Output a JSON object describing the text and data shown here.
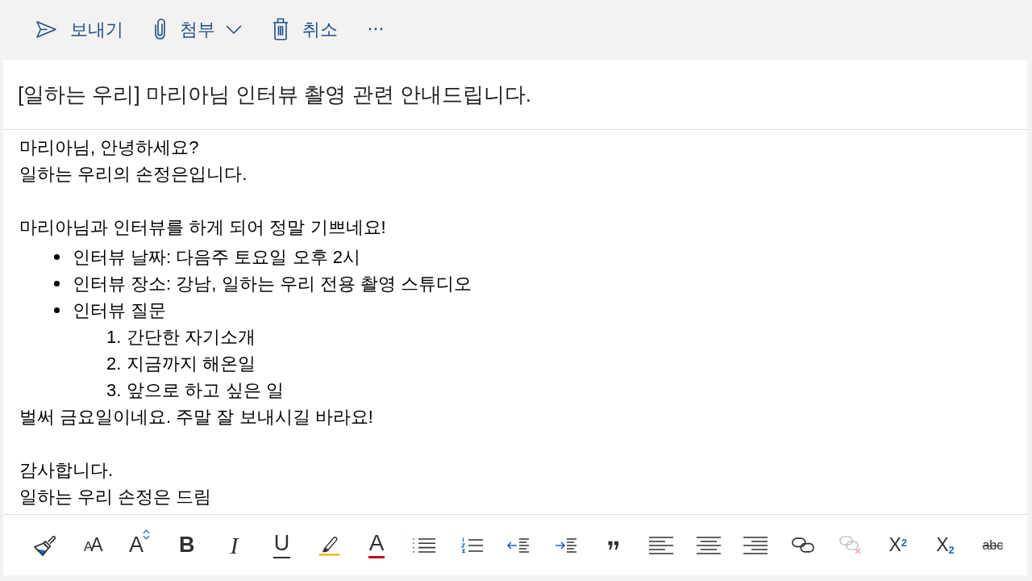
{
  "command_bar": {
    "items": [
      {
        "kind": "send",
        "label": "보내기",
        "has_menu": false
      },
      {
        "kind": "attach",
        "label": "첨부",
        "has_menu": true
      },
      {
        "kind": "discard",
        "label": "취소",
        "has_menu": false
      },
      {
        "kind": "more",
        "has_menu": false
      }
    ]
  },
  "subject": {
    "value": "[일하는 우리] 마리아님 인터뷰 촬영 관련 안내드립니다."
  },
  "body": {
    "sections": [
      {
        "blocks": [
          {
            "kind": "line",
            "text": "마리아님, 안녕하세요?"
          },
          {
            "kind": "line",
            "text": "일하는 우리의 손정은입니다."
          }
        ]
      },
      {
        "blocks": [
          {
            "kind": "line",
            "text": "마리아님과 인터뷰를 하게 되어 정말 기쁘네요!"
          },
          {
            "kind": "bullet_list",
            "items": [
              {
                "text": "인터뷰 날짜: 다음주 토요일 오후 2시"
              },
              {
                "text": "인터뷰 장소: 강남, 일하는 우리 전용 촬영 스튜디오"
              },
              {
                "text": "인터뷰 질문",
                "children": [
                  {
                    "number": "1.",
                    "text": "간단한 자기소개"
                  },
                  {
                    "number": "2.",
                    "text": "지금까지 해온일"
                  },
                  {
                    "number": "3.",
                    "text": "앞으로 하고 싶은 일"
                  }
                ]
              }
            ]
          },
          {
            "kind": "line",
            "text": "벌써 금요일이네요. 주말 잘 보내시길 바라요!"
          }
        ]
      },
      {
        "blocks": [
          {
            "kind": "line",
            "text": "감사합니다."
          },
          {
            "kind": "line",
            "text": "일하는 우리 손정은 드림"
          }
        ]
      }
    ]
  },
  "format_toolbar": {
    "items": [
      {
        "kind": "format_painter",
        "disabled": false
      },
      {
        "kind": "font",
        "label": "AA",
        "disabled": false
      },
      {
        "kind": "font_size",
        "label": "A",
        "disabled": false
      },
      {
        "kind": "bold",
        "label": "B",
        "disabled": false
      },
      {
        "kind": "italic",
        "label": "I",
        "disabled": false
      },
      {
        "kind": "underline",
        "label": "U",
        "disabled": false
      },
      {
        "kind": "highlight",
        "disabled": false
      },
      {
        "kind": "font_color",
        "label": "A",
        "disabled": false
      },
      {
        "kind": "bullets",
        "disabled": false
      },
      {
        "kind": "numbering",
        "disabled": false
      },
      {
        "kind": "outdent",
        "disabled": false
      },
      {
        "kind": "indent",
        "disabled": false
      },
      {
        "kind": "quote",
        "disabled": false
      },
      {
        "kind": "align_left",
        "disabled": false
      },
      {
        "kind": "align_center",
        "disabled": false
      },
      {
        "kind": "align_right",
        "disabled": false
      },
      {
        "kind": "link",
        "disabled": false
      },
      {
        "kind": "unlink",
        "disabled": true
      },
      {
        "kind": "superscript",
        "label": "X$^{2}$",
        "disabled": false
      },
      {
        "kind": "subscript",
        "label": "X$_{2}$",
        "disabled": false
      },
      {
        "kind": "strikethrough",
        "label": "abc",
        "disabled": false
      }
    ]
  }
}
